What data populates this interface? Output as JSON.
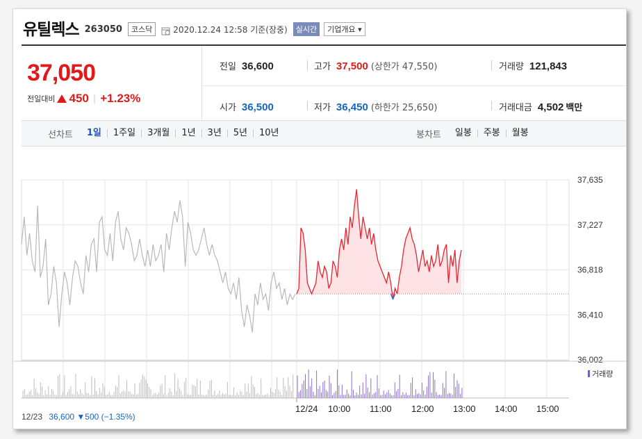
{
  "header": {
    "name": "유틸렉스",
    "code": "263050",
    "market": "코스닥",
    "datetime": "2020.12.24 12:58 기준(장중)",
    "realtime": "실시간",
    "overview": "기업개요 ▾"
  },
  "price": {
    "current": "37,050",
    "change_label": "전일대비",
    "change": "450",
    "direction": "up",
    "change_pct": "+1.23%"
  },
  "stats": {
    "prev_close": {
      "label": "전일",
      "value": "36,600"
    },
    "high": {
      "label": "고가",
      "value": "37,500",
      "sub": "(상한가 47,550)"
    },
    "volume": {
      "label": "거래량",
      "value": "121,843"
    },
    "open": {
      "label": "시가",
      "value": "36,500"
    },
    "low": {
      "label": "저가",
      "value": "36,450",
      "sub": "(하한가 25,650)"
    },
    "amount": {
      "label": "거래대금",
      "value": "4,502",
      "unit": "백만"
    }
  },
  "tabs": {
    "line_label": "선차트",
    "line_periods": [
      "1일",
      "1주일",
      "3개월",
      "1년",
      "3년",
      "5년",
      "10년"
    ],
    "active": "1일",
    "candle_label": "봉차트",
    "candle_periods": [
      "일봉",
      "주봉",
      "월봉"
    ]
  },
  "chart_data": {
    "type": "line",
    "y_ticks": [
      "37,635",
      "37,227",
      "36,818",
      "36,410",
      "36,002"
    ],
    "ylim": [
      36002,
      37635
    ],
    "x_ticks": [
      "12/23",
      "12/24",
      "10:00",
      "11:00",
      "12:00",
      "13:00",
      "14:00",
      "15:00"
    ],
    "reference_price": 36600,
    "prev_day_points": [
      37050,
      37300,
      36950,
      37150,
      36900,
      36800,
      37400,
      36750,
      36850,
      37100,
      36500,
      36600,
      36850,
      36700,
      36300,
      36600,
      36800,
      36700,
      36500,
      36750,
      36900,
      36850,
      36700,
      36600,
      36950,
      36800,
      37050,
      37100,
      36800,
      37250,
      37300,
      37000,
      36950,
      37150,
      36900,
      37250,
      37350,
      37100,
      37000,
      37200,
      37150,
      37050,
      36900,
      36950,
      37100,
      36950,
      36850,
      37000,
      36850,
      37050,
      36900,
      36950,
      37050,
      36800,
      37150,
      37000,
      37200,
      37350,
      37250,
      37450,
      37300,
      36850,
      37250,
      37150,
      37000,
      36950,
      37000,
      37100,
      37200,
      37050,
      36950,
      37050,
      36950,
      36900,
      36800,
      36700,
      36800,
      36650,
      36600,
      36700,
      36550,
      36750,
      36450,
      36300,
      36500,
      36400,
      36250,
      36600,
      36500,
      36700,
      36550,
      36600,
      36450,
      36700,
      36800,
      36650,
      36700,
      36550,
      36650,
      36500,
      36600,
      36550,
      36600
    ],
    "today_points": [
      36600,
      36650,
      37200,
      37150,
      37000,
      36700,
      36650,
      36600,
      36650,
      36700,
      36900,
      36800,
      36750,
      36850,
      36800,
      36650,
      36700,
      36900,
      36850,
      36750,
      37000,
      37100,
      37000,
      37200,
      37050,
      37300,
      37200,
      37400,
      37550,
      37300,
      37100,
      37300,
      37200,
      37100,
      37200,
      37050,
      37150,
      37000,
      36900,
      36850,
      36800,
      36750,
      36700,
      36800,
      36700,
      36550,
      36650,
      36600,
      36750,
      36850,
      37000,
      37100,
      37150,
      37200,
      37100,
      37050,
      36950,
      36800,
      36900,
      37000,
      36850,
      36900,
      36800,
      36950,
      36850,
      36900,
      37050,
      36850,
      36900,
      37000,
      37050,
      36700,
      36950,
      36850,
      37000,
      36700,
      36900,
      37000
    ],
    "volume_label": "거래량"
  },
  "prev_day": {
    "date": "12/23",
    "summary": "36,600 ▼500 (−1.35%)"
  }
}
